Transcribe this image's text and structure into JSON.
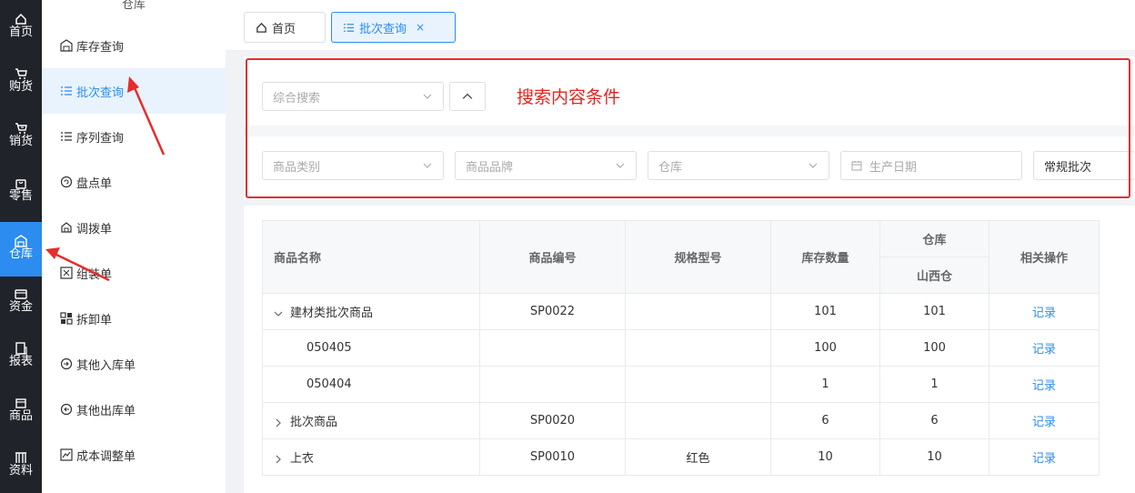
{
  "rail": {
    "items": [
      {
        "label": "首页",
        "icon": "home-icon"
      },
      {
        "label": "购货",
        "icon": "cart-icon"
      },
      {
        "label": "销货",
        "icon": "cart-out-icon"
      },
      {
        "label": "零售",
        "icon": "bag-icon"
      },
      {
        "label": "仓库",
        "icon": "warehouse-icon",
        "active": true
      },
      {
        "label": "资金",
        "icon": "money-icon"
      },
      {
        "label": "报表",
        "icon": "report-icon"
      },
      {
        "label": "商品",
        "icon": "box-icon"
      },
      {
        "label": "资料",
        "icon": "database-icon"
      }
    ],
    "active_color": "#2d8cf0"
  },
  "submenu": {
    "title": "仓库",
    "items": [
      {
        "label": "库存查询",
        "icon": "warehouse-icon"
      },
      {
        "label": "批次查询",
        "icon": "list-icon",
        "active": true
      },
      {
        "label": "序列查询",
        "icon": "list-ordered-icon"
      },
      {
        "label": "盘点单",
        "icon": "refresh-circle-icon"
      },
      {
        "label": "调拨单",
        "icon": "house-icon"
      },
      {
        "label": "组装单",
        "icon": "assemble-icon"
      },
      {
        "label": "拆卸单",
        "icon": "disassemble-icon"
      },
      {
        "label": "其他入库单",
        "icon": "inbound-icon"
      },
      {
        "label": "其他出库单",
        "icon": "outbound-icon"
      },
      {
        "label": "成本调整单",
        "icon": "adjust-icon"
      }
    ]
  },
  "tabs": [
    {
      "label": "首页",
      "icon": "home-icon"
    },
    {
      "label": "批次查询",
      "icon": "list-icon",
      "active": true,
      "close": "×"
    }
  ],
  "search": {
    "general_placeholder": "综合搜索",
    "annotation": "搜索内容条件",
    "category_placeholder": "商品类别",
    "brand_placeholder": "商品品牌",
    "warehouse_placeholder": "仓库",
    "date_placeholder": "生产日期",
    "batch_type_value": "常规批次"
  },
  "table": {
    "headers": {
      "name": "商品名称",
      "code": "商品编号",
      "spec": "规格型号",
      "stock": "库存数量",
      "warehouse_group": "仓库",
      "warehouse_sub": "山西仓",
      "ops": "相关操作"
    },
    "rows": [
      {
        "name": "建材类批次商品",
        "code": "SP0022",
        "spec": "",
        "stock": "101",
        "wh": "101",
        "op": "记录",
        "expander": "expanded"
      },
      {
        "name": "050405",
        "code": "",
        "spec": "",
        "stock": "100",
        "wh": "100",
        "op": "记录",
        "expander": "child"
      },
      {
        "name": "050404",
        "code": "",
        "spec": "",
        "stock": "1",
        "wh": "1",
        "op": "记录",
        "expander": "child"
      },
      {
        "name": "批次商品",
        "code": "SP0020",
        "spec": "",
        "stock": "6",
        "wh": "6",
        "op": "记录",
        "expander": "collapsed"
      },
      {
        "name": "上衣",
        "code": "SP0010",
        "spec": "红色",
        "stock": "10",
        "wh": "10",
        "op": "记录",
        "expander": "collapsed"
      }
    ]
  },
  "colors": {
    "accent": "#2d8cf0",
    "annotation_red": "#e62d2d",
    "rail_bg": "#20232a"
  }
}
